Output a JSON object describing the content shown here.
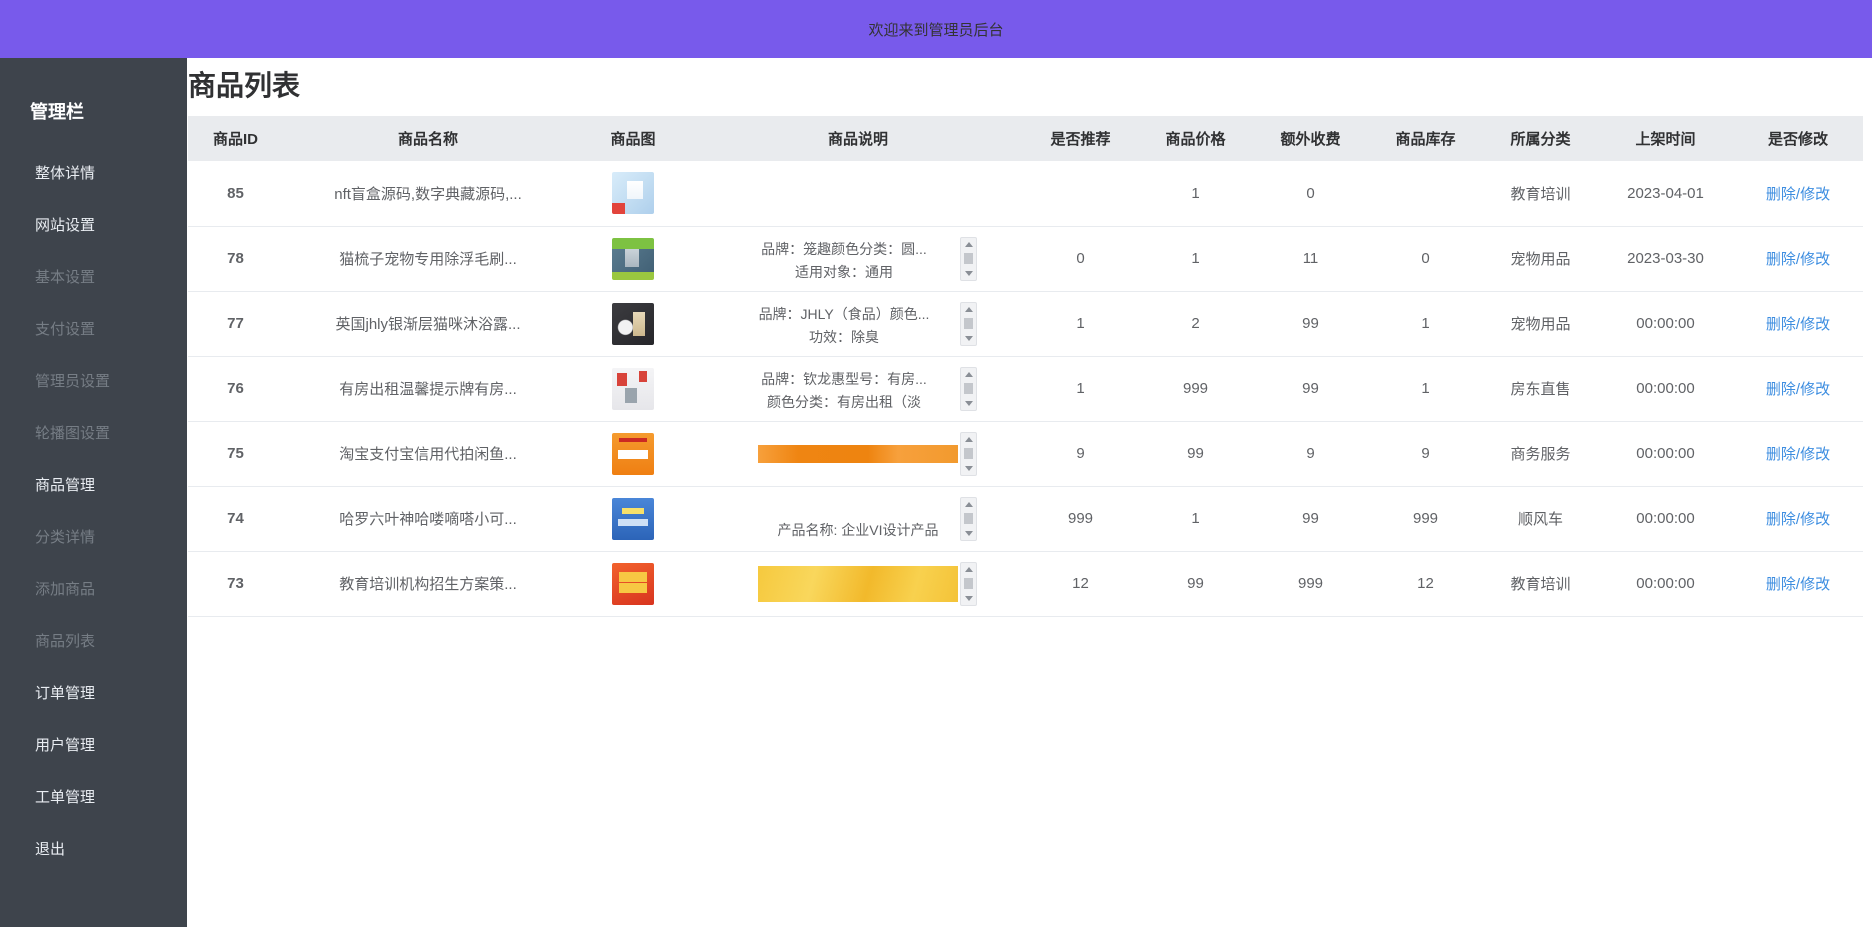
{
  "topbar": {
    "welcome_text": "欢迎来到管理员后台",
    "bg_color": "#785aeb"
  },
  "sidebar": {
    "title": "管理栏",
    "bg_color": "#3e444c",
    "items": [
      {
        "label": "整体详情",
        "state": "normal"
      },
      {
        "label": "网站设置",
        "state": "normal"
      },
      {
        "label": "基本设置",
        "state": "dimmed"
      },
      {
        "label": "支付设置",
        "state": "dimmed"
      },
      {
        "label": "管理员设置",
        "state": "dimmed"
      },
      {
        "label": "轮播图设置",
        "state": "dimmed"
      },
      {
        "label": "商品管理",
        "state": "normal"
      },
      {
        "label": "分类详情",
        "state": "dimmed"
      },
      {
        "label": "添加商品",
        "state": "dimmed"
      },
      {
        "label": "商品列表",
        "state": "dimmed"
      },
      {
        "label": "订单管理",
        "state": "normal"
      },
      {
        "label": "用户管理",
        "state": "normal"
      },
      {
        "label": "工单管理",
        "state": "normal"
      },
      {
        "label": "退出",
        "state": "normal"
      }
    ]
  },
  "main": {
    "page_title": "商品列表",
    "link_color": "#3c8de0",
    "table": {
      "headers": [
        "商品ID",
        "商品名称",
        "商品图",
        "商品说明",
        "是否推荐",
        "商品价格",
        "额外收费",
        "商品库存",
        "所属分类",
        "上架时间",
        "是否修改"
      ],
      "rows": [
        {
          "id": "85",
          "name": "nft盲盒源码,数字典藏源码,...",
          "image": "nft-blindbox-product-thumbnail",
          "desc1": "",
          "desc2": "",
          "recommend": "",
          "price": "1",
          "extra_fee": "0",
          "stock": "",
          "category": "教育培训",
          "shelf_time": "2023-04-01",
          "action": "删除/修改"
        },
        {
          "id": "78",
          "name": "猫梳子宠物专用除浮毛刷...",
          "image": "cat-comb-product-thumbnail",
          "desc1": "品牌：笼趣颜色分类：圆...",
          "desc2": "适用对象：通用",
          "recommend": "0",
          "price": "1",
          "extra_fee": "11",
          "stock": "0",
          "category": "宠物用品",
          "shelf_time": "2023-03-30",
          "action": "删除/修改"
        },
        {
          "id": "77",
          "name": "英国jhly银渐层猫咪沐浴露...",
          "image": "cat-shampoo-product-thumbnail",
          "desc1": "品牌：JHLY（食品）颜色...",
          "desc2": "功效：除臭",
          "recommend": "1",
          "price": "2",
          "extra_fee": "99",
          "stock": "1",
          "category": "宠物用品",
          "shelf_time": "00:00:00",
          "action": "删除/修改"
        },
        {
          "id": "76",
          "name": "有房出租温馨提示牌有房...",
          "image": "rent-sign-product-thumbnail",
          "desc1": "品牌：钦龙惠型号：有房...",
          "desc2": "颜色分类：有房出租（淡",
          "recommend": "1",
          "price": "999",
          "extra_fee": "99",
          "stock": "1",
          "category": "房东直售",
          "shelf_time": "00:00:00",
          "action": "删除/修改"
        },
        {
          "id": "75",
          "name": "淘宝支付宝信用代拍闲鱼...",
          "image": "credit-service-product-thumbnail",
          "desc_image": "orange-banner-image",
          "recommend": "9",
          "price": "99",
          "extra_fee": "9",
          "stock": "9",
          "category": "商务服务",
          "shelf_time": "00:00:00",
          "action": "删除/修改"
        },
        {
          "id": "74",
          "name": "哈罗六叶神哈喽嘀嗒小可...",
          "image": "hitchhike-service-product-thumbnail",
          "desc_bottom": "产品名称: 企业VI设计产品",
          "recommend": "999",
          "price": "1",
          "extra_fee": "99",
          "stock": "999",
          "category": "顺风车",
          "shelf_time": "00:00:00",
          "action": "删除/修改"
        },
        {
          "id": "73",
          "name": "教育培训机构招生方案策...",
          "image": "education-plan-product-thumbnail",
          "desc_image": "yellow-banner-image",
          "recommend": "12",
          "price": "99",
          "extra_fee": "999",
          "stock": "12",
          "category": "教育培训",
          "shelf_time": "00:00:00",
          "action": "删除/修改"
        }
      ]
    }
  }
}
